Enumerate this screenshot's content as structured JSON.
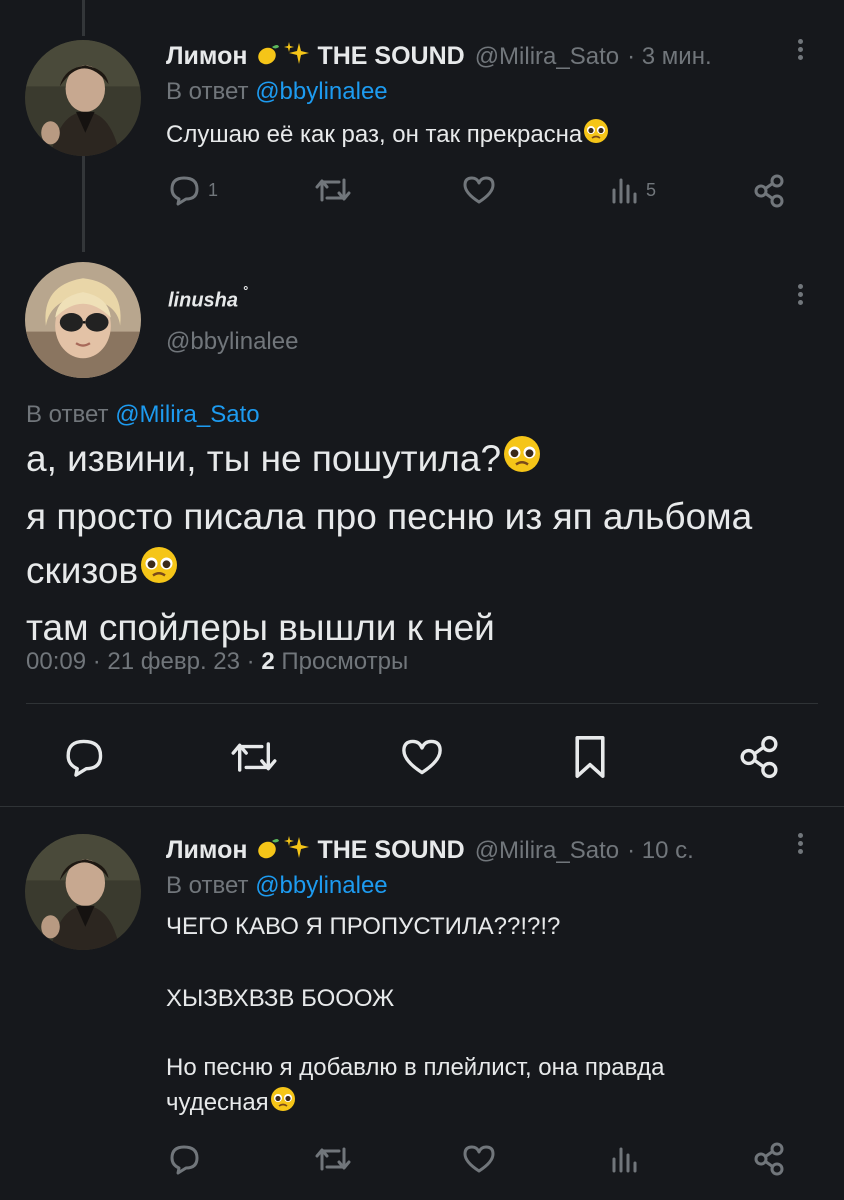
{
  "tweets": [
    {
      "name": "Лимон",
      "badge": "THE SOUND",
      "handle": "@Milira_Sato",
      "time": "· 3 мин.",
      "reply_prefix": "В ответ",
      "reply_mention": "@bbylinalee",
      "text": "Слушаю её как раз, он так прекрасна",
      "replies": "1",
      "views": "5"
    },
    {
      "name": "Лимон",
      "badge": "THE SOUND",
      "handle": "@Milira_Sato",
      "time": "· 10 с.",
      "reply_prefix": "В ответ",
      "reply_mention": "@bbylinalee",
      "lines": [
        "ЧЕГО КАВО Я ПРОПУСТИЛА??!?!?",
        "ХЫЗВХВЗВ БОООЖ",
        "Но песню я добавлю в плейлист, она правда",
        "чудесная"
      ]
    }
  ],
  "main": {
    "name": "linusha",
    "name_suffix": "˚",
    "handle": "@bbylinalee",
    "reply_prefix": "В ответ",
    "reply_mention": "@Milira_Sato",
    "lines": [
      "а, извини, ты не пошутила?",
      "я просто писала про песню из яп альбома",
      "скизов",
      "там спойлеры вышли к ней"
    ],
    "time": "00:09 · 21 февр. 23 ·",
    "views_count": "2",
    "views_label": "Просмотры"
  },
  "icons": {
    "reply": "reply-icon",
    "retweet": "retweet-icon",
    "like": "heart-icon",
    "views": "views-icon",
    "share": "share-icon",
    "bookmark": "bookmark-icon",
    "more": "more-icon"
  },
  "colors": {
    "background": "#16181c",
    "text": "#e7e9ea",
    "secondary": "#71767b",
    "link": "#1d9bf0"
  }
}
